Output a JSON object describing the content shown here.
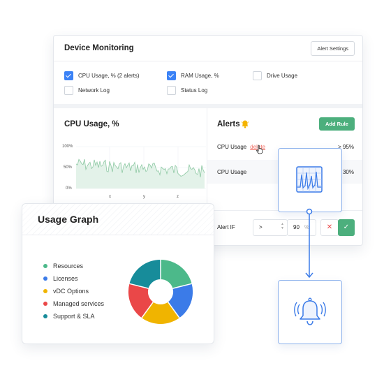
{
  "device_monitoring": {
    "title": "Device Monitoring",
    "alert_settings_label": "Alert Settings",
    "checkboxes": [
      {
        "label": "CPU Usage, % (2 alerts)",
        "checked": true
      },
      {
        "label": "RAM Usage, %",
        "checked": true
      },
      {
        "label": "Drive Usage",
        "checked": false
      },
      {
        "label": "Network Log",
        "checked": false
      },
      {
        "label": "Status Log",
        "checked": false
      }
    ]
  },
  "cpu_chart": {
    "title": "CPU Usage, %",
    "y_ticks": [
      "100%",
      "50%",
      "0%"
    ],
    "x_ticks": [
      "x",
      "y",
      "z"
    ]
  },
  "alerts": {
    "title": "Alerts",
    "add_rule_label": "Add Rule",
    "rows": [
      {
        "name": "CPU Usage",
        "action": "delete",
        "value": "> 95%"
      },
      {
        "name": "CPU Usage",
        "action": "",
        "value": "30%"
      }
    ],
    "alert_if": {
      "label": "Alert IF",
      "operator": ">",
      "value": "90",
      "unit": "%"
    }
  },
  "usage_graph": {
    "title": "Usage Graph",
    "legend": [
      {
        "label": "Resources",
        "color": "#4cb98a"
      },
      {
        "label": "Licenses",
        "color": "#3b7be8"
      },
      {
        "label": "vDC Options",
        "color": "#f0b400"
      },
      {
        "label": "Managed services",
        "color": "#ea4748"
      },
      {
        "label": "Support & SLA",
        "color": "#178c9a"
      }
    ]
  },
  "colors": {
    "accent": "#3b82f6",
    "green": "#4caf7d",
    "delete_red": "#f06a5f",
    "bell": "#f4b400"
  }
}
